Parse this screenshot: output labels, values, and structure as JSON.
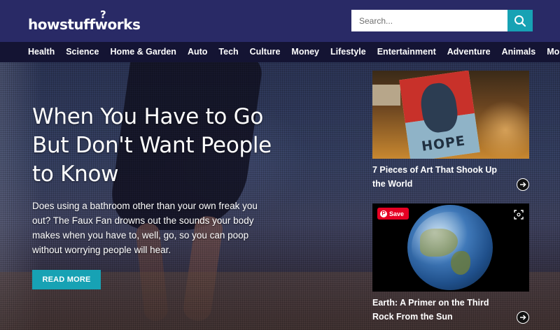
{
  "header": {
    "logo": "howstuffworks",
    "search": {
      "placeholder": "Search..."
    }
  },
  "nav": {
    "items": [
      "Health",
      "Science",
      "Home & Garden",
      "Auto",
      "Tech",
      "Culture",
      "Money",
      "Lifestyle",
      "Entertainment",
      "Adventure",
      "Animals"
    ],
    "more_label": "More"
  },
  "hero": {
    "title": "When You Have to Go But Don't Want People to Know",
    "dek": "Does using a bathroom other than your own freak you out? The Faux Fan drowns out the sounds your body makes when you have to, well, go, so you can poop without worrying people will hear.",
    "cta": "READ MORE"
  },
  "cards": [
    {
      "title": "7 Pieces of Art That Shook Up the World",
      "image_text": "HOPE"
    },
    {
      "title": "Earth: A Primer on the Third Rock From the Sun",
      "pin_label": "Save"
    }
  ],
  "colors": {
    "header": "#292a66",
    "nav": "#141433",
    "accent": "#17a2b4",
    "pinterest": "#e60023"
  }
}
